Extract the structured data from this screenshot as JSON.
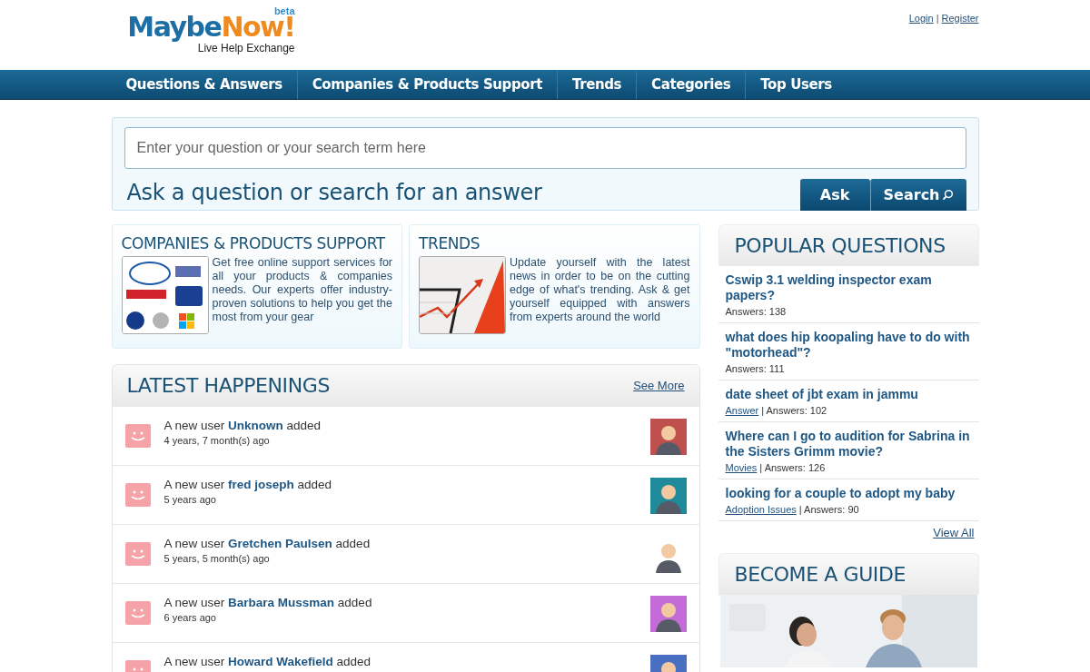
{
  "logo": {
    "first": "Maybe",
    "second": "Now!",
    "badge": "beta",
    "tagline": "Live Help Exchange"
  },
  "account_links": {
    "login": "Login",
    "separator": "|",
    "register": "Register"
  },
  "nav": [
    "Questions & Answers",
    "Companies & Products Support",
    "Trends",
    "Categories",
    "Top Users"
  ],
  "search": {
    "placeholder": "Enter your question or your search term here",
    "heading": "Ask a question or search for an answer",
    "buttons": [
      {
        "kind": "ask",
        "label": "Ask"
      },
      {
        "kind": "search",
        "label": "Search"
      }
    ]
  },
  "features": [
    {
      "kind": "companies",
      "title": "COMPANIES & PRODUCTS SUPPORT",
      "text": "Get free online support services for all your products & companies needs. Our experts offer industry-proven solutions to help you get the most from your gear"
    },
    {
      "kind": "trends",
      "title": "TRENDS",
      "text": "Update yourself with the latest news in order to be on the cutting edge of what's trending. Ask & get yourself equipped with answers from experts around the world"
    }
  ],
  "latest": {
    "title": "LATEST HAPPENINGS",
    "see_more": "See More",
    "items": [
      {
        "text": "A new user **Unknown** added",
        "time": "4 years, 7 month(s) ago",
        "color": "#c0504d"
      },
      {
        "text": "A new user **fred joseph** added",
        "time": "5 years ago",
        "color": "#1f8a9a"
      },
      {
        "text": "A new user **Gretchen Paulsen** added",
        "time": "5 years, 5 month(s) ago",
        "color": "#ffffff"
      },
      {
        "text": "A new user **Barbara Mussman** added",
        "time": "6 years ago",
        "color": "#c36bd6"
      },
      {
        "text": "A new user **Howard Wakefield** added",
        "color": "#4a6fc2"
      }
    ]
  },
  "popular": {
    "title": "POPULAR QUESTIONS",
    "items": [
      {
        "question": "Cswip 3.1 welding inspector exam papers?",
        "answers": "Answers: 138"
      },
      {
        "question": "what does hip koopaling have to do with \"motorhead\"?",
        "answers": "Answers: 111"
      },
      {
        "question": "date sheet of jbt exam in jammu",
        "category": "Answer",
        "answers": "| Answers: 102"
      },
      {
        "question": "Where can I go to audition for Sabrina in the Sisters Grimm movie?",
        "category": "Movies",
        "answers": "| Answers: 126"
      },
      {
        "question": "looking for a couple to adopt my baby",
        "category": "Adoption Issues ",
        "answers": "| Answers: 90"
      }
    ],
    "view_all": "View All"
  },
  "guide": {
    "title": "BECOME A GUIDE"
  }
}
